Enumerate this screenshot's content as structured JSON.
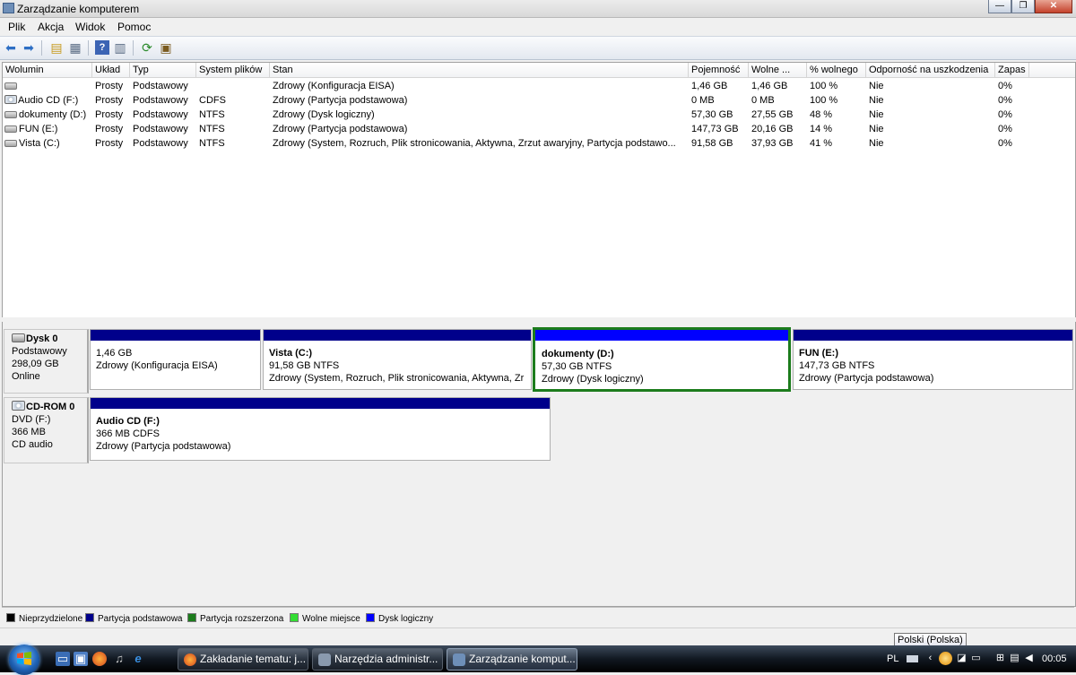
{
  "window": {
    "title": "Zarządzanie komputerem",
    "btn_min": "—",
    "btn_max": "❐",
    "btn_close": "✕"
  },
  "menu": [
    "Plik",
    "Akcja",
    "Widok",
    "Pomoc"
  ],
  "toolbar_icons": [
    "back-arrow-icon",
    "forward-arrow-icon",
    "up-folder-icon",
    "show-hide-tree-icon",
    "help-icon",
    "properties-icon",
    "refresh-icon",
    "export-icon"
  ],
  "volume_table": {
    "columns": [
      "Wolumin",
      "Układ",
      "Typ",
      "System plików",
      "Stan",
      "Pojemność",
      "Wolne ...",
      "% wolnego",
      "Odporność na uszkodzenia",
      "Zapas"
    ],
    "rows": [
      [
        "",
        "Prosty",
        "Podstawowy",
        "",
        "Zdrowy (Konfiguracja EISA)",
        "1,46 GB",
        "1,46 GB",
        "100 %",
        "Nie",
        "0%"
      ],
      [
        "Audio CD (F:)",
        "Prosty",
        "Podstawowy",
        "CDFS",
        "Zdrowy (Partycja podstawowa)",
        "0 MB",
        "0 MB",
        "100 %",
        "Nie",
        "0%"
      ],
      [
        "dokumenty (D:)",
        "Prosty",
        "Podstawowy",
        "NTFS",
        "Zdrowy (Dysk logiczny)",
        "57,30 GB",
        "27,55 GB",
        "48 %",
        "Nie",
        "0%"
      ],
      [
        "FUN (E:)",
        "Prosty",
        "Podstawowy",
        "NTFS",
        "Zdrowy (Partycja podstawowa)",
        "147,73 GB",
        "20,16 GB",
        "14 %",
        "Nie",
        "0%"
      ],
      [
        "Vista (C:)",
        "Prosty",
        "Podstawowy",
        "NTFS",
        "Zdrowy (System, Rozruch, Plik stronicowania, Aktywna, Zrzut awaryjny, Partycja podstawo...",
        "91,58 GB",
        "37,93 GB",
        "41 %",
        "Nie",
        "0%"
      ]
    ]
  },
  "disks": [
    {
      "name": "Dysk 0",
      "type": "Podstawowy",
      "size": "298,09 GB",
      "status": "Online",
      "partitions": [
        {
          "name": "",
          "size": "1,46 GB",
          "status": "Zdrowy (Konfiguracja EISA)",
          "selected": false
        },
        {
          "name": "Vista  (C:)",
          "size": "91,58 GB NTFS",
          "status": "Zdrowy (System, Rozruch, Plik stronicowania, Aktywna, Zr",
          "selected": false
        },
        {
          "name": "dokumenty  (D:)",
          "size": "57,30 GB NTFS",
          "status": "Zdrowy (Dysk logiczny)",
          "selected": true
        },
        {
          "name": "FUN  (E:)",
          "size": "147,73 GB NTFS",
          "status": "Zdrowy (Partycja podstawowa)",
          "selected": false
        }
      ]
    },
    {
      "name": "CD-ROM 0",
      "type": "DVD (F:)",
      "size": "366 MB",
      "status": "CD audio",
      "partitions": [
        {
          "name": "Audio CD  (F:)",
          "size": "366 MB CDFS",
          "status": "Zdrowy (Partycja podstawowa)",
          "selected": false
        }
      ]
    }
  ],
  "legend": [
    {
      "label": "Nieprzydzielone",
      "color": "#000000"
    },
    {
      "label": "Partycja podstawowa",
      "color": "#00008b"
    },
    {
      "label": "Partycja rozszerzona",
      "color": "#1c7c1c"
    },
    {
      "label": "Wolne miejsce",
      "color": "#33dd33"
    },
    {
      "label": "Dysk logiczny",
      "color": "#0000ff"
    }
  ],
  "tooltip": "Polski (Polska)",
  "taskbar": {
    "tasks": [
      {
        "label": "Zakładanie tematu: j...",
        "icon": "firefox-icon",
        "active": false
      },
      {
        "label": "Narzędzia administr...",
        "icon": "admin-tools-icon",
        "active": false
      },
      {
        "label": "Zarządzanie komput...",
        "icon": "computer-management-icon",
        "active": true
      }
    ],
    "lang": "PL",
    "clock": "00:05"
  }
}
